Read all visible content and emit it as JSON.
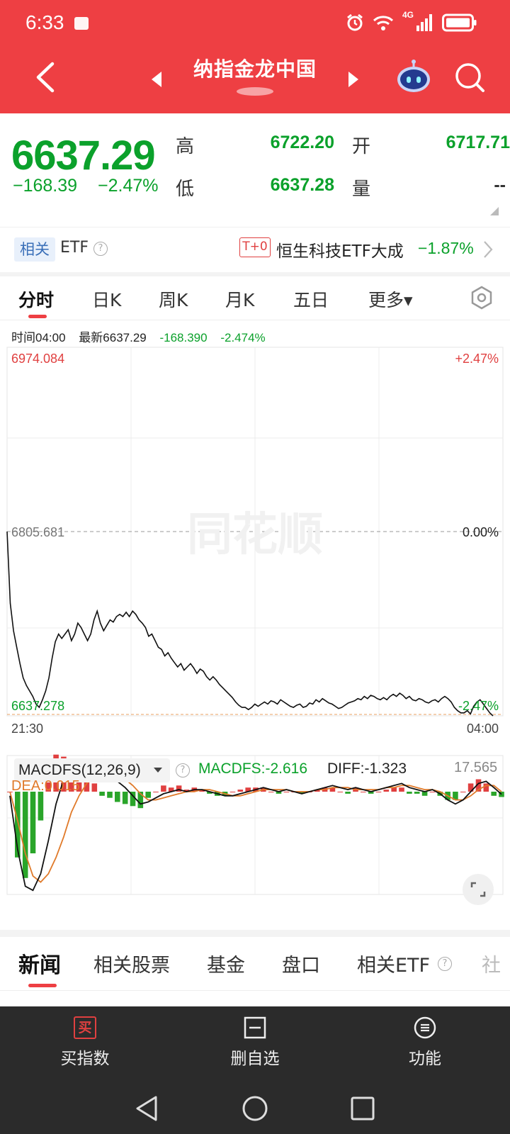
{
  "status_bar": {
    "time": "6:33",
    "network": "4G"
  },
  "header": {
    "title": "纳指金龙中国"
  },
  "quote": {
    "price": "6637.29",
    "change": "−168.39",
    "change_pct": "−2.47%",
    "high_label": "高",
    "high_value": "6722.20",
    "low_label": "低",
    "low_value": "6637.28",
    "open_label": "开",
    "open_value": "6717.71",
    "volume_label": "量",
    "volume_value": "--"
  },
  "etf": {
    "badge": "相关",
    "label": "ETF",
    "t0_badge": "T+0",
    "name": "恒生科技ETF大成",
    "pct": "−1.87%"
  },
  "tabs": [
    {
      "label": "分时",
      "active": true
    },
    {
      "label": "日K"
    },
    {
      "label": "周K"
    },
    {
      "label": "月K"
    },
    {
      "label": "五日"
    },
    {
      "label": "更多▾"
    }
  ],
  "info_line": {
    "time": "时间04:00",
    "latest": "最新6637.29",
    "change": "-168.390",
    "change_pct": "-2.474%"
  },
  "chart_data": [
    {
      "type": "line",
      "y_ticks_left": [
        "6974.084",
        "6805.681",
        "6637.278"
      ],
      "y_ticks_right": [
        "+2.47%",
        "0.00%",
        "-2.47%"
      ],
      "x_ticks": [
        "21:30",
        "04:00"
      ],
      "ylim": [
        6637.278,
        6974.084
      ],
      "reference_value": 6805.681,
      "watermark": "同花顺",
      "series": [
        {
          "values": [
            6805.7,
            6740,
            6715,
            6700,
            6685,
            6672,
            6665,
            6660,
            6655,
            6648,
            6645,
            6652,
            6660,
            6672,
            6690,
            6705,
            6712,
            6708,
            6712,
            6716,
            6706,
            6712,
            6722,
            6718,
            6712,
            6706,
            6712,
            6725,
            6733,
            6722,
            6715,
            6720,
            6725,
            6723,
            6728,
            6730,
            6728,
            6732,
            6728,
            6733,
            6730,
            6725,
            6722,
            6718,
            6710,
            6712,
            6706,
            6700,
            6698,
            6692,
            6695,
            6690,
            6686,
            6682,
            6685,
            6679,
            6682,
            6685,
            6681,
            6676,
            6680,
            6678,
            6673,
            6670,
            6673,
            6670,
            6666,
            6663,
            6660,
            6657,
            6654,
            6650,
            6647,
            6645,
            6645,
            6643,
            6645,
            6648,
            6646,
            6648,
            6650,
            6648,
            6651,
            6650,
            6648,
            6652,
            6650,
            6648,
            6646,
            6645,
            6647,
            6648,
            6645,
            6646,
            6649,
            6648,
            6652,
            6650,
            6653,
            6651,
            6649,
            6648,
            6646,
            6644,
            6645,
            6647,
            6649,
            6650,
            6651,
            6653,
            6652,
            6655,
            6653,
            6656,
            6655,
            6653,
            6652,
            6654,
            6652,
            6655,
            6657,
            6655,
            6658,
            6656,
            6653,
            6655,
            6652,
            6651,
            6653,
            6652,
            6650,
            6649,
            6651,
            6652,
            6650,
            6653,
            6655,
            6653,
            6650,
            6645,
            6642,
            6640,
            6640,
            6642,
            6639,
            6646,
            6650,
            6652,
            6648,
            6644,
            6640,
            6637.3
          ]
        }
      ]
    },
    {
      "type": "bar",
      "indicator_label": "MACDFS(12,26,9)",
      "macdfs_label": "MACDFS:",
      "macdfs_value": "-2.616",
      "diff_label": "DIFF:",
      "diff_value": "-1.323",
      "dea_label": "DEA:",
      "dea_value": "0.015",
      "top_value": "17.565",
      "ylim": [
        -50,
        17.565
      ],
      "colors": {
        "positive": "#e04040",
        "negative": "#2aa52a",
        "diff": "#111111",
        "dea": "#e07a2a"
      },
      "series": [
        {
          "name": "DIFF",
          "values": [
            -2,
            -28,
            -46,
            -48,
            -40,
            -24,
            -6,
            6,
            10,
            8,
            9,
            9,
            7,
            6,
            5,
            2,
            -2,
            -6,
            -5,
            -3,
            -1,
            0,
            1,
            0,
            1,
            1,
            0,
            -1,
            -2,
            -2,
            -1,
            0,
            1,
            2,
            1,
            0,
            1,
            0,
            -1,
            0,
            1,
            2,
            3,
            2,
            1,
            2,
            1,
            0,
            1,
            2,
            3,
            4,
            2,
            1,
            0,
            1,
            -1,
            -4,
            -6,
            -4,
            0,
            4,
            5,
            2,
            -1.3
          ]
        },
        {
          "name": "DEA",
          "values": [
            0,
            -14,
            -30,
            -41,
            -44,
            -40,
            -32,
            -22,
            -10,
            -2,
            4,
            8,
            9,
            9,
            8,
            6,
            3,
            -1,
            -4,
            -4,
            -3,
            -2,
            -1,
            0,
            0,
            1,
            1,
            0,
            -1,
            -2,
            -2,
            -1,
            0,
            1,
            1,
            1,
            1,
            0,
            0,
            0,
            1,
            1,
            2,
            2,
            2,
            1,
            1,
            1,
            1,
            2,
            2,
            3,
            3,
            2,
            1,
            1,
            0,
            -2,
            -4,
            -4,
            -2,
            1,
            3,
            3,
            0.015
          ]
        },
        {
          "name": "MACDFS",
          "values": [
            0,
            -32,
            -42,
            -30,
            -14,
            10,
            18,
            17,
            12,
            8,
            6,
            4,
            -2,
            -3,
            -5,
            -6,
            -7,
            -8,
            -3,
            0,
            3,
            2,
            3,
            1,
            2,
            1,
            -1,
            -2,
            -2,
            0,
            1,
            2,
            2,
            2,
            0,
            -1,
            0,
            0,
            -1,
            0,
            1,
            2,
            2,
            0,
            -1,
            2,
            0,
            -1,
            0,
            1,
            2,
            2,
            -1,
            -1,
            -2,
            0,
            -2,
            -4,
            -4,
            0,
            4,
            6,
            4,
            -2,
            -2.6
          ]
        }
      ]
    }
  ],
  "news_tabs": [
    {
      "label": "新闻",
      "active": true
    },
    {
      "label": "相关股票"
    },
    {
      "label": "基金"
    },
    {
      "label": "盘口"
    },
    {
      "label": "相关ETF"
    },
    {
      "label": "社"
    }
  ],
  "bottom_bar": {
    "buy": {
      "label": "买指数",
      "icon_text": "买"
    },
    "remove": {
      "label": "删自选"
    },
    "function": {
      "label": "功能"
    }
  }
}
